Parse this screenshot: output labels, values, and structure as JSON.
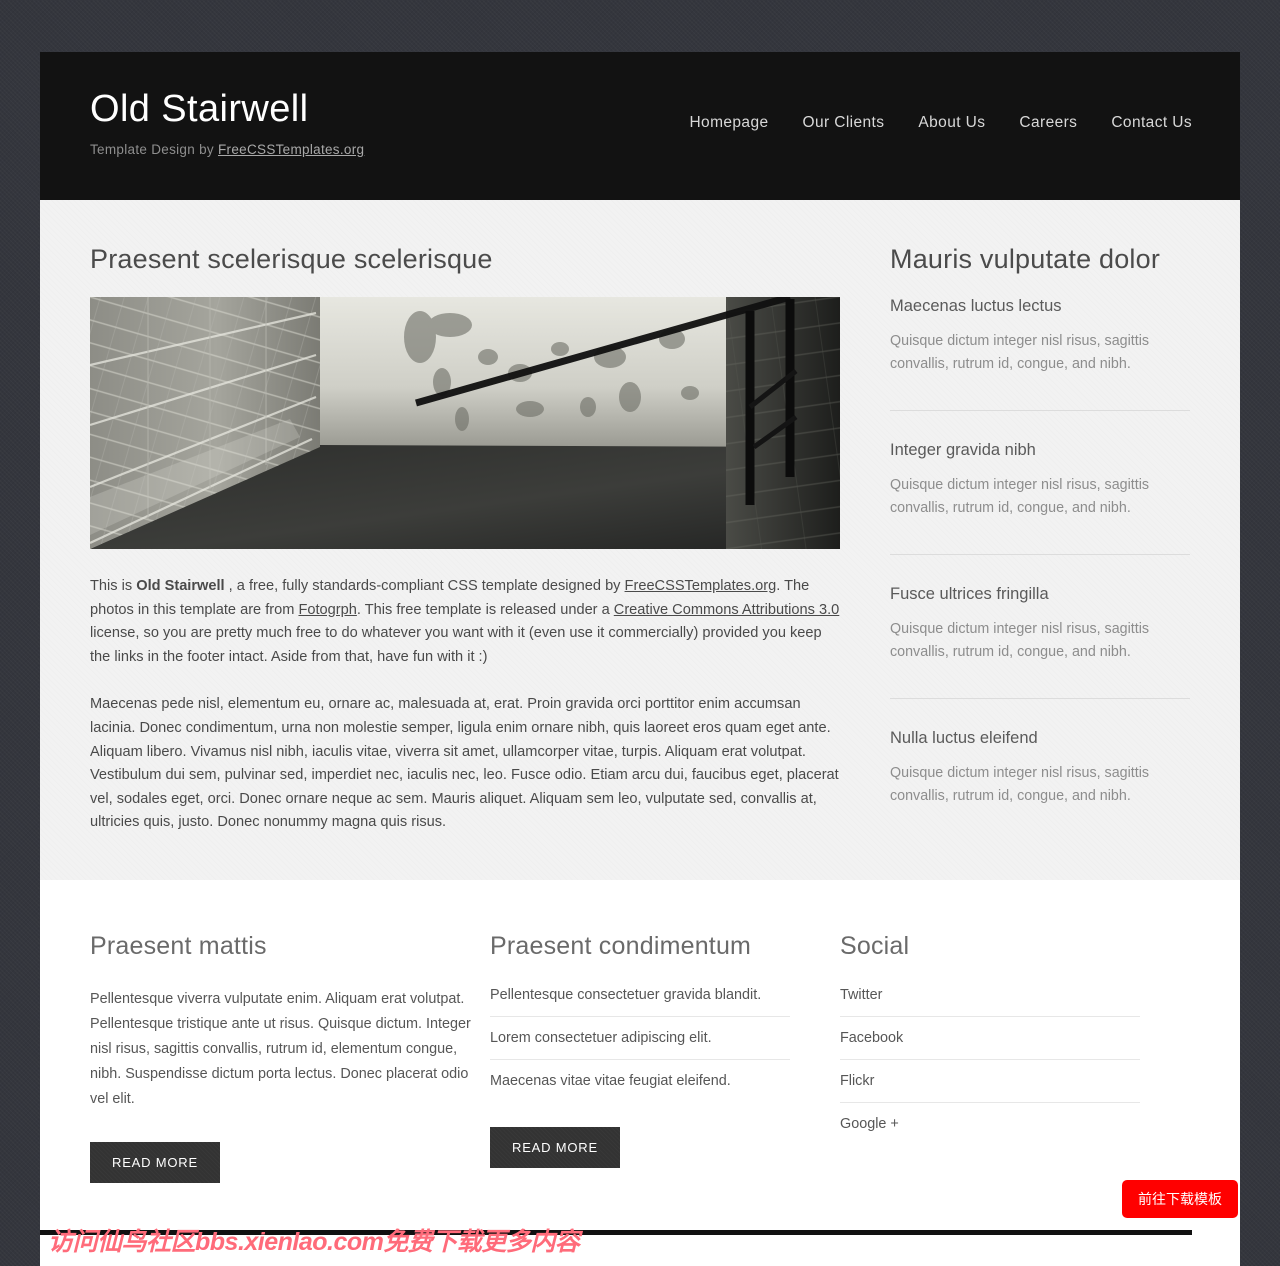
{
  "header": {
    "brand_title": "Old Stairwell",
    "credit_prefix": "Template Design by ",
    "credit_link": "FreeCSSTemplates.org",
    "nav": [
      {
        "label": "Homepage"
      },
      {
        "label": "Our Clients"
      },
      {
        "label": "About Us"
      },
      {
        "label": "Careers"
      },
      {
        "label": "Contact Us"
      }
    ]
  },
  "main": {
    "title": "Praesent scelerisque scelerisque",
    "image_alt": "old-stairwell-photo",
    "paragraph1": {
      "part1": "This is ",
      "bold1": "Old Stairwell",
      "part2": " , a free, fully standards-compliant CSS template designed by ",
      "link1": "FreeCSSTemplates.org",
      "part3": ". The photos in this template are from ",
      "link2": "Fotogrph",
      "part4": ". This free template is released under a ",
      "link3": "Creative Commons Attributions 3.0",
      "part5": " license, so you are pretty much free to do whatever you want with it (even use it commercially) provided you keep the links in the footer intact. Aside from that, have fun with it :)"
    },
    "paragraph2": "Maecenas pede nisl, elementum eu, ornare ac, malesuada at, erat. Proin gravida orci porttitor enim accumsan lacinia. Donec condimentum, urna non molestie semper, ligula enim ornare nibh, quis laoreet eros quam eget ante. Aliquam libero. Vivamus nisl nibh, iaculis vitae, viverra sit amet, ullamcorper vitae, turpis. Aliquam erat volutpat. Vestibulum dui sem, pulvinar sed, imperdiet nec, iaculis nec, leo. Fusce odio. Etiam arcu dui, faucibus eget, placerat vel, sodales eget, orci. Donec ornare neque ac sem. Mauris aliquet. Aliquam sem leo, vulputate sed, convallis at, ultricies quis, justo. Donec nonummy magna quis risus."
  },
  "sidebar": {
    "title": "Mauris vulputate dolor",
    "items": [
      {
        "heading": "Maecenas luctus lectus",
        "text": "Quisque dictum integer nisl risus, sagittis convallis, rutrum id, congue, and nibh."
      },
      {
        "heading": "Integer gravida nibh",
        "text": "Quisque dictum integer nisl risus, sagittis convallis, rutrum id, congue, and nibh."
      },
      {
        "heading": "Fusce ultrices fringilla",
        "text": "Quisque dictum integer nisl risus, sagittis convallis, rutrum id, congue, and nibh."
      },
      {
        "heading": "Nulla luctus eleifend",
        "text": "Quisque dictum integer nisl risus, sagittis convallis, rutrum id, congue, and nibh."
      }
    ]
  },
  "footer": {
    "col1": {
      "title": "Praesent mattis",
      "text": "Pellentesque viverra vulputate enim. Aliquam erat volutpat. Pellentesque tristique ante ut risus. Quisque dictum. Integer nisl risus, sagittis convallis, rutrum id, elementum congue, nibh. Suspendisse dictum porta lectus. Donec placerat odio vel elit.",
      "button": "READ MORE"
    },
    "col2": {
      "title": "Praesent condimentum",
      "items": [
        "Pellentesque consectetuer gravida blandit.",
        "Lorem consectetuer adipiscing elit.",
        "Maecenas vitae vitae feugiat eleifend."
      ],
      "button": "READ MORE"
    },
    "col3": {
      "title": "Social",
      "items": [
        "Twitter",
        "Facebook",
        "Flickr",
        "Google +"
      ]
    }
  },
  "overlay": {
    "download_button": "前往下载模板",
    "watermark": "访问仙鸟社区bbs.xienlao.com免费下载更多内容"
  },
  "colors": {
    "page_background": "#34363d",
    "header_background": "#121212",
    "main_background": "#f2f2f2",
    "accent_red": "#ff0000",
    "button_dark": "#333333",
    "watermark_pink": "#ff6b7a"
  }
}
